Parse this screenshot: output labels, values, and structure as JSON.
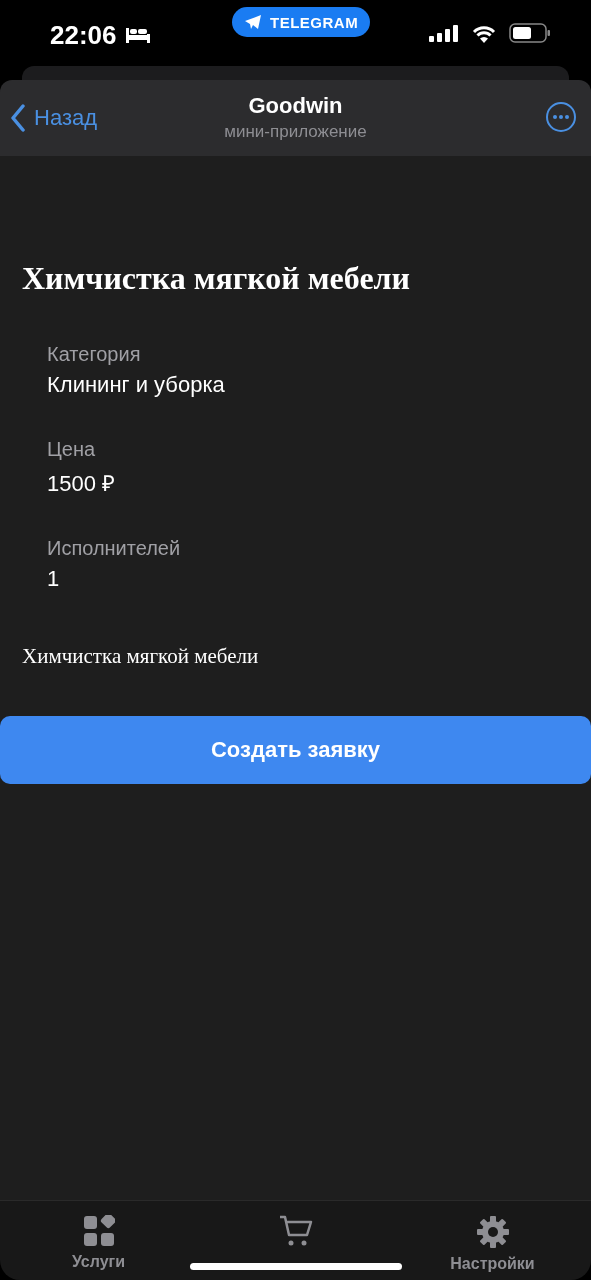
{
  "status_bar": {
    "time": "22:06",
    "app_pill": "TELEGRAM"
  },
  "header": {
    "back": "Назад",
    "title": "Goodwin",
    "subtitle": "мини-приложение"
  },
  "service": {
    "title": "Химчистка мягкой мебели",
    "fields": [
      {
        "label": "Категория",
        "value": "Клининг и уборка"
      },
      {
        "label": "Цена",
        "value": "1500 ₽"
      },
      {
        "label": "Исполнителей",
        "value": "1"
      }
    ],
    "description": "Химчистка мягкой мебели",
    "button": "Создать заявку"
  },
  "tab_bar": {
    "items": [
      {
        "kind": "services",
        "label": "Услуги"
      },
      {
        "kind": "cart"
      },
      {
        "kind": "settings",
        "label": "Настройки"
      }
    ]
  }
}
